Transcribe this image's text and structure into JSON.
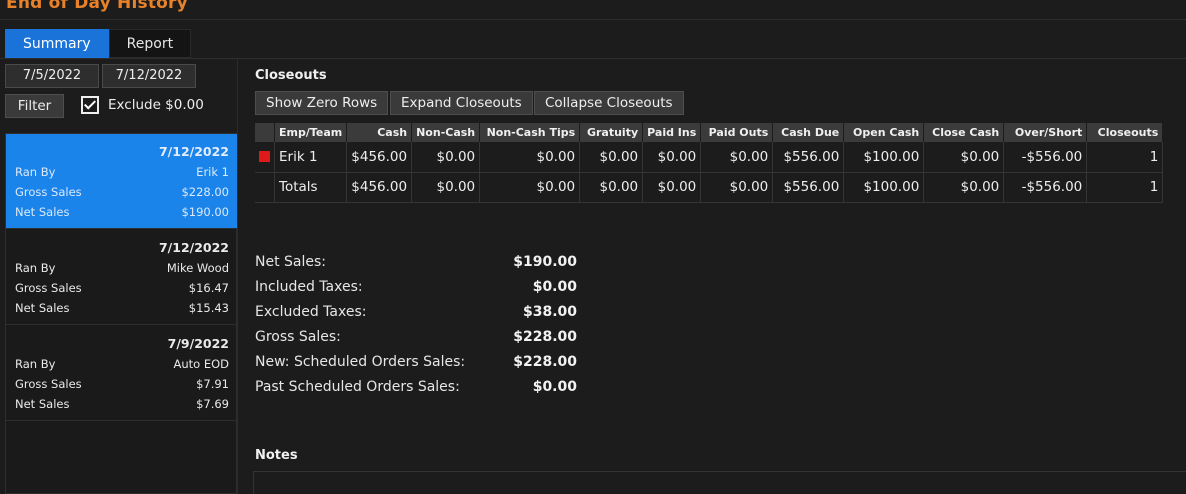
{
  "window": {
    "title": "End of Day History"
  },
  "tabs": [
    {
      "label": "Summary",
      "active": true
    },
    {
      "label": "Report",
      "active": false
    }
  ],
  "filters": {
    "start_date": "7/5/2022",
    "end_date": "7/12/2022",
    "filter_label": "Filter",
    "exclude_label": "Exclude $0.00",
    "exclude_checked": true
  },
  "history": [
    {
      "date": "7/12/2022",
      "ran_by_label": "Ran By",
      "ran_by": "Erik 1",
      "gross_label": "Gross Sales",
      "gross": "$228.00",
      "net_label": "Net Sales",
      "net": "$190.00",
      "selected": true
    },
    {
      "date": "7/12/2022",
      "ran_by_label": "Ran By",
      "ran_by": "Mike Wood",
      "gross_label": "Gross Sales",
      "gross": "$16.47",
      "net_label": "Net Sales",
      "net": "$15.43",
      "selected": false
    },
    {
      "date": "7/9/2022",
      "ran_by_label": "Ran By",
      "ran_by": "Auto EOD",
      "gross_label": "Gross Sales",
      "gross": "$7.91",
      "net_label": "Net Sales",
      "net": "$7.69",
      "selected": false
    }
  ],
  "closeouts": {
    "title": "Closeouts",
    "buttons": {
      "zero_rows": "Show Zero Rows",
      "expand": "Expand Closeouts",
      "collapse": "Collapse Closeouts"
    },
    "columns": [
      "",
      "Emp/Team",
      "Cash",
      "Non-Cash",
      "Non-Cash Tips",
      "Gratuity",
      "Paid Ins",
      "Paid Outs",
      "Cash Due",
      "Open Cash",
      "Close Cash",
      "Over/Short",
      "Closeouts"
    ],
    "rows": [
      [
        "",
        "Erik 1",
        "$456.00",
        "$0.00",
        "$0.00",
        "$0.00",
        "$0.00",
        "$0.00",
        "$556.00",
        "$100.00",
        "$0.00",
        "-$556.00",
        "1"
      ],
      [
        "",
        "Totals",
        "$456.00",
        "$0.00",
        "$0.00",
        "$0.00",
        "$0.00",
        "$0.00",
        "$556.00",
        "$100.00",
        "$0.00",
        "-$556.00",
        "1"
      ]
    ],
    "indicator_color": "#e0191b"
  },
  "summary": [
    {
      "label": "Net Sales:",
      "value": "$190.00"
    },
    {
      "label": "Included Taxes:",
      "value": "$0.00"
    },
    {
      "label": "Excluded Taxes:",
      "value": "$38.00"
    },
    {
      "label": "Gross Sales:",
      "value": "$228.00"
    },
    {
      "label": "New: Scheduled Orders Sales:",
      "value": "$228.00"
    },
    {
      "label": "Past Scheduled Orders Sales:",
      "value": "$0.00"
    }
  ],
  "notes": {
    "title": "Notes",
    "value": ""
  },
  "colors": {
    "title": "#e8822a",
    "accent": "#1a73d9",
    "selected_card": "#1a84ea"
  }
}
